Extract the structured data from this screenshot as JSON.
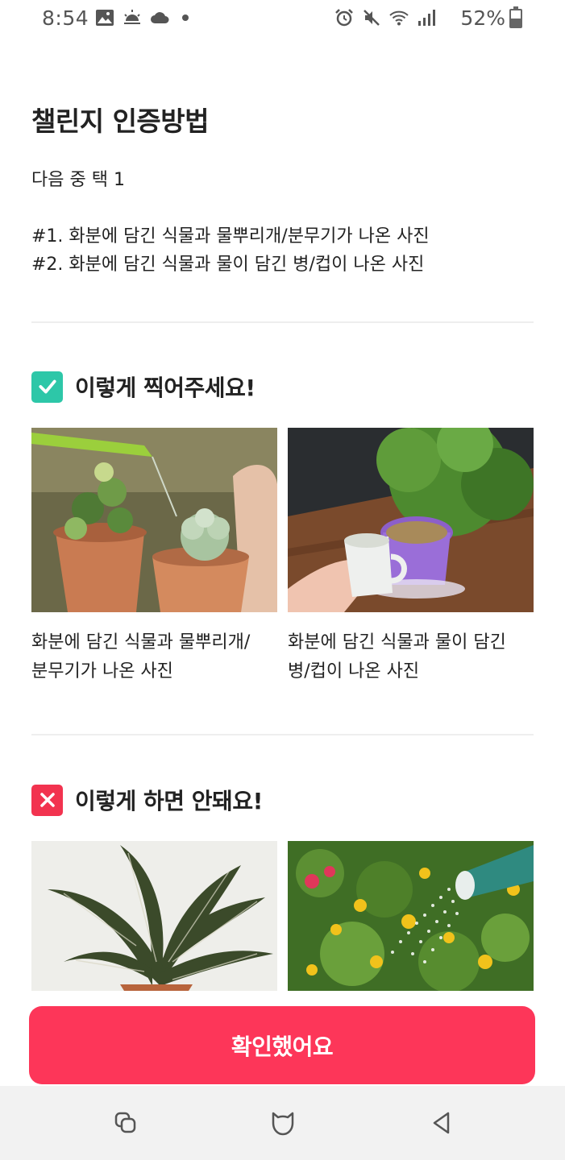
{
  "status_bar": {
    "time": "8:54",
    "battery": "52%",
    "battery_level": 0.52,
    "left_icons": [
      "gallery-icon",
      "weather-sun-icon",
      "cloud-icon",
      "notification-dot-icon"
    ],
    "right_icons": [
      "alarm-icon",
      "mute-icon",
      "wifi-icon",
      "signal-icon"
    ]
  },
  "page": {
    "title": "챌린지 인증방법",
    "subtitle": "다음 중 택 1",
    "methods": [
      "#1. 화분에 담긴 식물과 물뿌리개/분무기가 나온 사진",
      "#2. 화분에 담긴 식물과 물이 담긴 병/컵이 나온 사진"
    ]
  },
  "good_section": {
    "title": "이렇게 찍어주세요!",
    "icon": "check-icon",
    "color": "#2dc7a8",
    "examples": [
      {
        "caption": "화분에 담긴 식물과 물뿌리개/\n분무기가 나온 사진",
        "image": "watering-can-plants-photo"
      },
      {
        "caption": "화분에 담긴 식물과 물이 담긴\n병/컵이 나온 사진",
        "image": "cup-water-plant-photo"
      }
    ]
  },
  "bad_section": {
    "title": "이렇게 하면 안돼요!",
    "icon": "x-icon",
    "color": "#f2334f",
    "examples": [
      {
        "image": "plant-only-photo"
      },
      {
        "image": "garden-watering-photo"
      }
    ]
  },
  "confirm_button": {
    "label": "확인했어요",
    "color": "#fd3659"
  },
  "nav_bar": {
    "icons": [
      "recent-apps-icon",
      "home-icon",
      "back-icon"
    ]
  }
}
